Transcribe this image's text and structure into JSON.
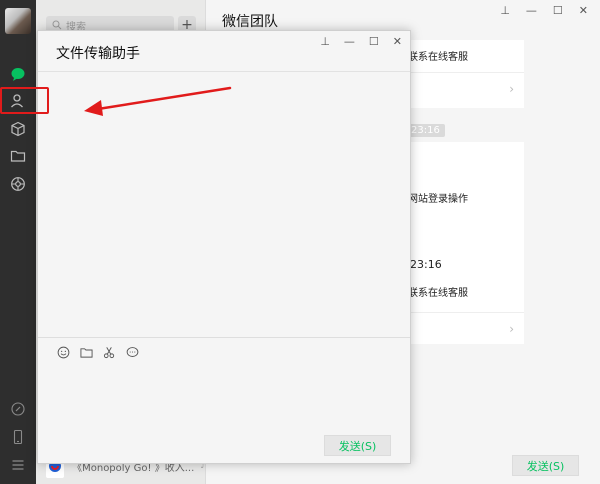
{
  "sidebar": {
    "icons": [
      "chat-icon",
      "contacts-icon",
      "box-icon",
      "folder-icon",
      "moments-icon",
      "link-icon",
      "phone-icon",
      "menu-icon"
    ]
  },
  "list": {
    "search_placeholder": "搜索",
    "add_label": "+",
    "bottom_item_text": "《Monopoly Go! 》收入...",
    "bottom_item_mute": "♪"
  },
  "main": {
    "title": "微信团队",
    "card1_line": "联系在线客服",
    "timestamp": "23:16",
    "card2_line1": "网站登录操作",
    "card2_line2": "23:16",
    "card2_line3": "联系在线客服",
    "send_label": "发送(S)",
    "chevron": "›"
  },
  "popup": {
    "title": "文件传输助手",
    "send_label": "发送(S)"
  },
  "window_controls": {
    "pin": "⊥",
    "minimize": "—",
    "maximize": "☐",
    "close": "✕"
  },
  "colors": {
    "accent_green": "#07c160",
    "highlight_red": "#e11b1b"
  }
}
